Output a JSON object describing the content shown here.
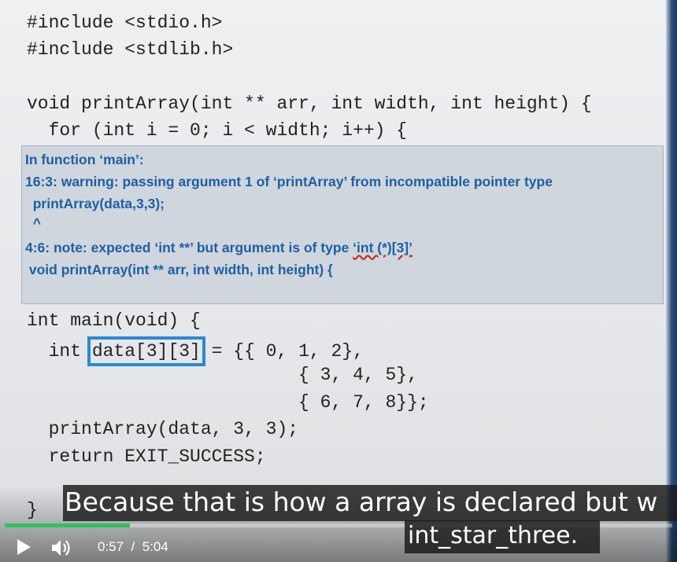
{
  "code_top": [
    "#include <stdio.h>",
    "#include <stdlib.h>",
    "void printArray(int ** arr, int width, int height) {",
    "  for (int i = 0; i < width; i++) {"
  ],
  "warning": {
    "line1": "In function ‘main’:",
    "line2": "16:3: warning: passing argument 1 of ‘printArray’ from incompatible pointer type",
    "line3": "  printArray(data,3,3);",
    "line4": "  ^",
    "line5_prefix": "4:6: note: expected ‘int **’ but argument is of type ",
    "line5_type": "‘int (*)[3]’",
    "line6": " void printArray(int ** arr, int width, int height) {"
  },
  "code_bottom": {
    "main_line": "int main(void) {",
    "decl_prefix": "  int ",
    "decl_highlight": "data[3][3]",
    "decl_suffix": " = {{ 0, 1, 2},",
    "row2": "                         { 3, 4, 5},",
    "row3": "                         { 6, 7, 8}};",
    "call_line": "  printArray(data, 3, 3);",
    "return_line": "  return EXIT_SUCCESS;",
    "close_brace": "}"
  },
  "subtitles": {
    "line1": "Because that is how a array is declared but w",
    "line2": "int_star_three."
  },
  "player": {
    "current_time": "0:57",
    "separator": "/",
    "duration": "5:04",
    "progress_fraction": 0.188,
    "accent_color": "#2fc25b"
  },
  "icons": {
    "play": "play-icon",
    "volume": "volume-icon"
  }
}
